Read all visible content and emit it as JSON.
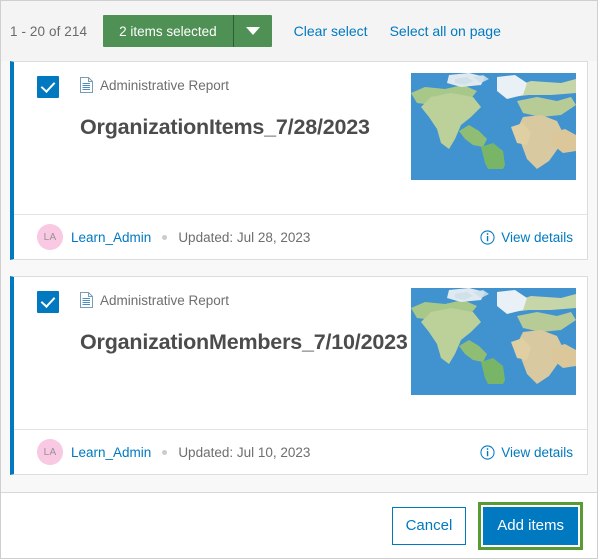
{
  "toolbar": {
    "count_text": "1 - 20 of 214",
    "select_button_label": "2 items selected",
    "dropdown_icon": "chevron-down-icon",
    "clear_select_label": "Clear select",
    "select_all_label": "Select all on page",
    "accent_green": "#4f9155",
    "link_blue": "#0079c1"
  },
  "items": [
    {
      "checked": true,
      "type_icon": "document-report-icon",
      "type_label": "Administrative Report",
      "title": "OrganizationItems_7/28/2023",
      "thumbnail": "world-map-thumbnail",
      "owner_initials": "LA",
      "owner_name": "Learn_Admin",
      "updated_text": "Updated: Jul 28, 2023",
      "view_details_label": "View details",
      "view_details_icon": "info-circle-icon"
    },
    {
      "checked": true,
      "type_icon": "document-report-icon",
      "type_label": "Administrative Report",
      "title": "OrganizationMembers_7/10/2023",
      "thumbnail": "world-map-thumbnail",
      "owner_initials": "LA",
      "owner_name": "Learn_Admin",
      "updated_text": "Updated: Jul 10, 2023",
      "view_details_label": "View details",
      "view_details_icon": "info-circle-icon"
    }
  ],
  "actions": {
    "cancel_label": "Cancel",
    "add_items_label": "Add items",
    "add_items_highlight_color": "#589b32",
    "add_items_color": "#0079c1"
  }
}
